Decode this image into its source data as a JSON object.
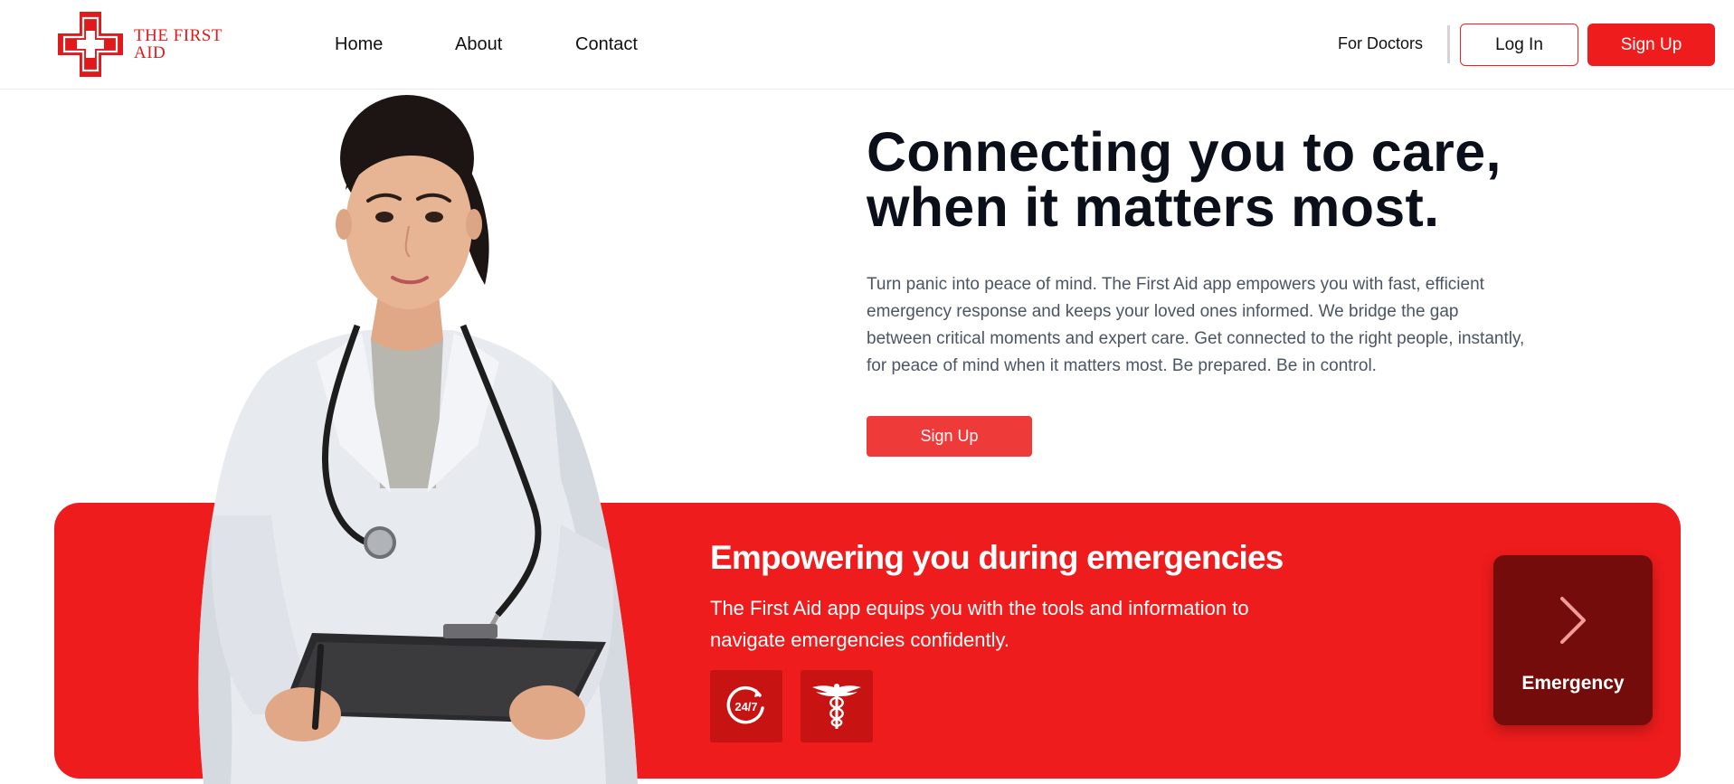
{
  "brand": {
    "name": "THE FIRST AID",
    "logo_icon": "red-cross-icon",
    "color": "#ee1c1c"
  },
  "nav": {
    "links": [
      {
        "label": "Home"
      },
      {
        "label": "About"
      },
      {
        "label": "Contact"
      }
    ],
    "for_doctors": "For Doctors",
    "login_label": "Log In",
    "signup_label": "Sign Up"
  },
  "hero": {
    "title_line1": "Connecting you to care,",
    "title_line2": "when it matters most.",
    "description": "Turn panic into peace of mind. The First Aid app empowers you with fast, efficient emergency response and keeps your loved ones informed. We bridge the gap between critical moments and expert care. Get connected to the right people, instantly, for peace of mind when it matters most. Be prepared. Be in control.",
    "cta_label": "Sign Up",
    "image": "doctor-with-stethoscope-and-clipboard"
  },
  "banner": {
    "title": "Empowering you during emergencies",
    "description": "The First Aid app equips you with the tools and information to navigate emergencies confidently.",
    "features": [
      {
        "icon": "clock-24-7-icon",
        "label": "24/7"
      },
      {
        "icon": "caduceus-icon"
      }
    ],
    "emergency": {
      "label": "Emergency",
      "icon": "chevron-right-icon"
    },
    "background_color": "#ee1c1c",
    "card_color": "#750c0c"
  }
}
